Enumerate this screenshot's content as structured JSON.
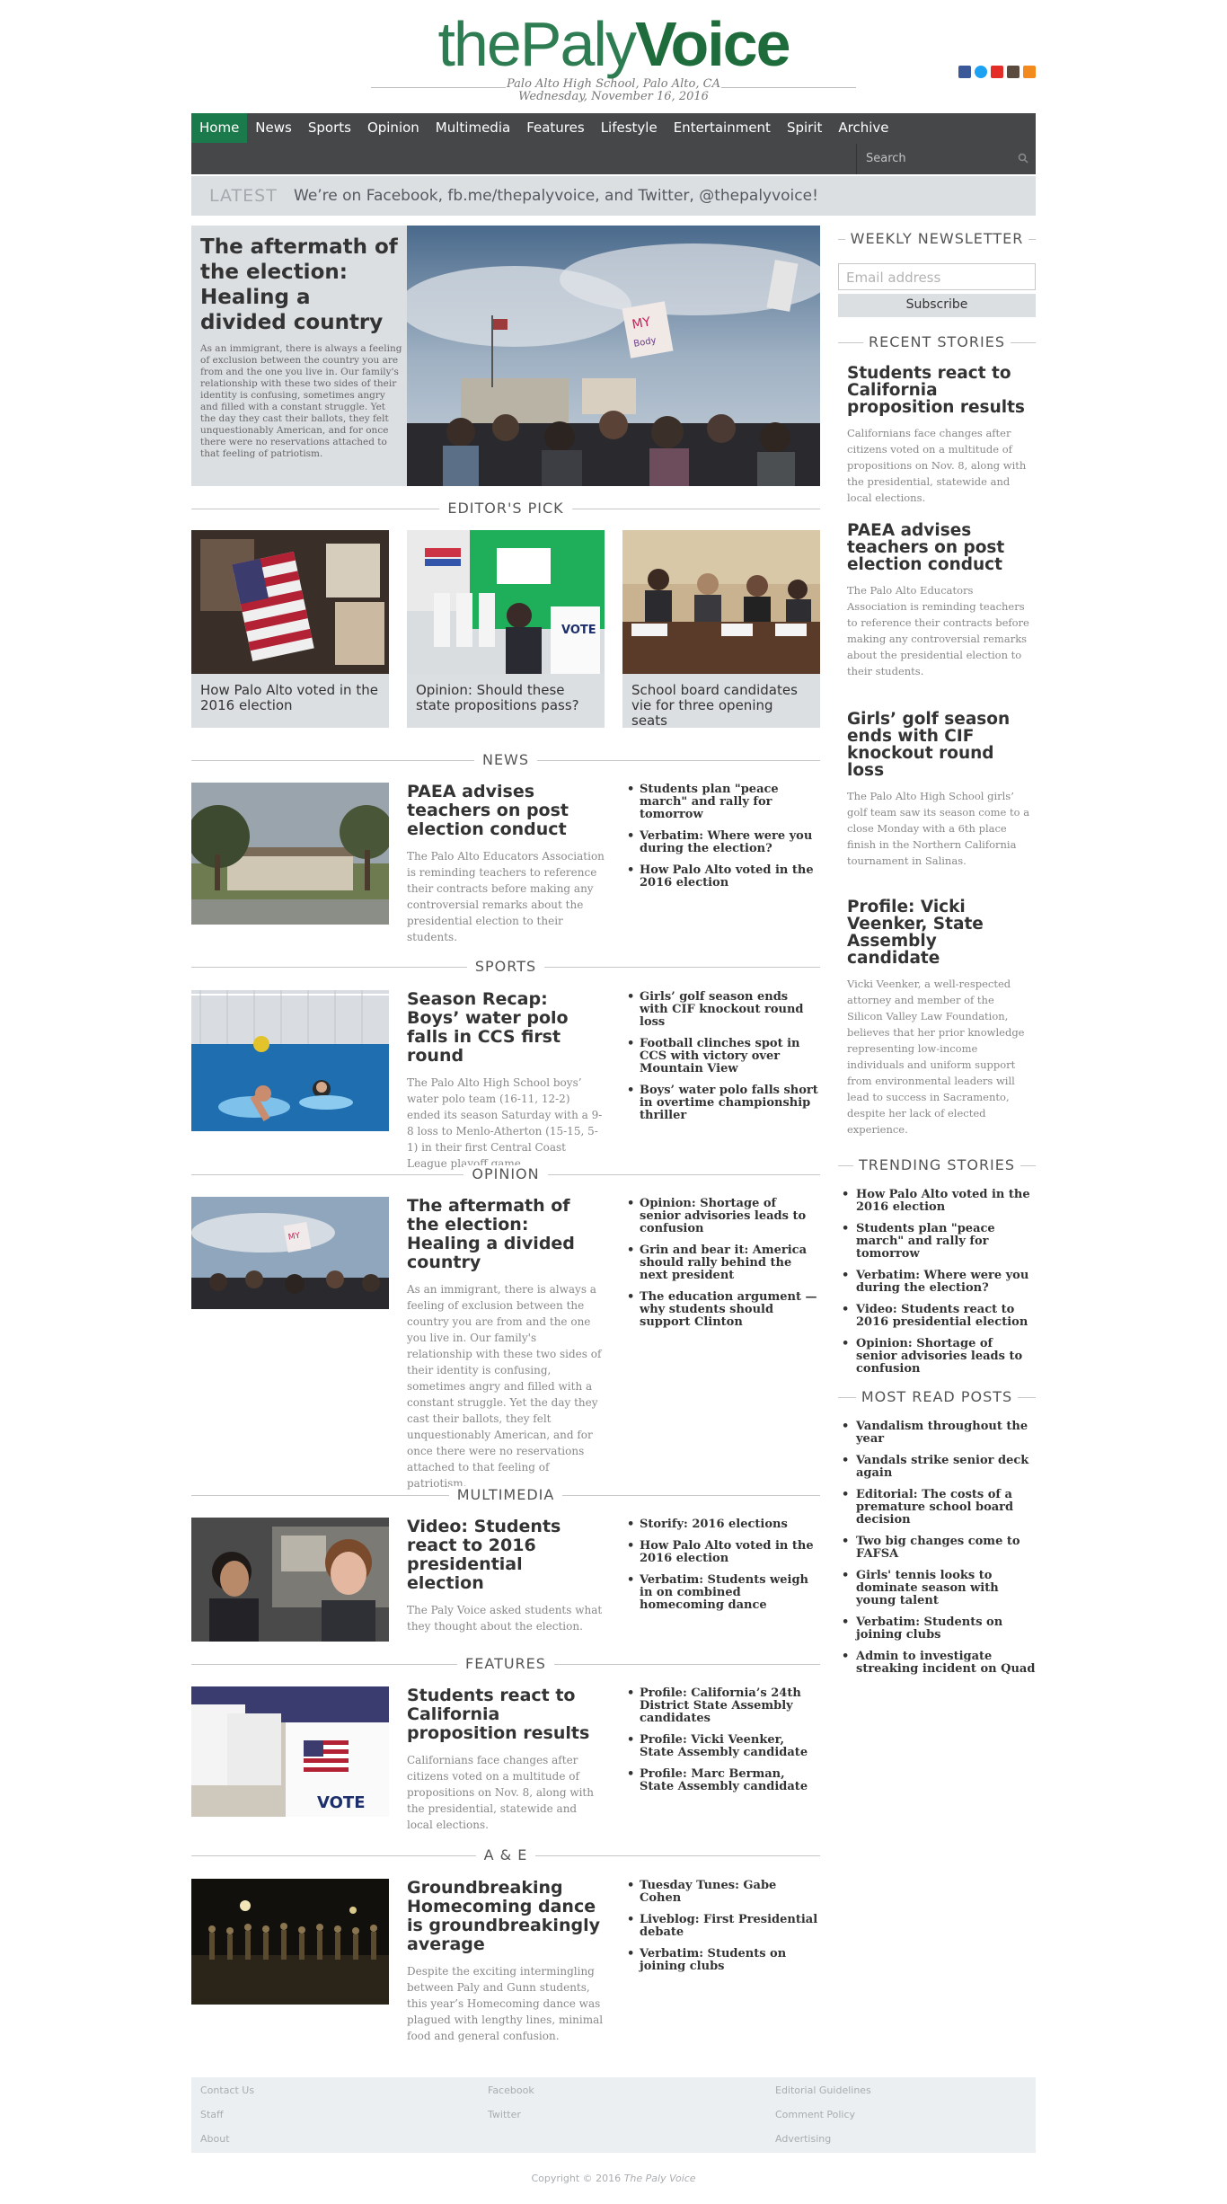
{
  "masthead": {
    "logo_part1": "thePaly",
    "logo_part2": "Voice",
    "school": "Palo Alto High School, Palo Alto, CA",
    "date": "Wednesday, November 16, 2016",
    "social_icons": [
      "facebook-icon",
      "twitter-icon",
      "youtube-icon",
      "instagram-icon",
      "rss-icon"
    ]
  },
  "nav": {
    "items": [
      "Home",
      "News",
      "Sports",
      "Opinion",
      "Multimedia",
      "Features",
      "Lifestyle",
      "Entertainment",
      "Spirit",
      "Archive"
    ],
    "active": "Home",
    "search_placeholder": "Search"
  },
  "latest": {
    "tag": "LATEST",
    "message": "We’re on Facebook, fb.me/thepalyvoice, and Twitter, @thepalyvoice!"
  },
  "hero": {
    "title": "The aftermath of the election: Healing a divided country",
    "excerpt": "As an immigrant, there is always a feeling of exclusion between the country you are from and the one you live in. Our family's relationship with these two sides of their identity is confusing, sometimes angry and filled with a constant struggle. Yet the day they cast their ballots, they felt unquestionably American, and for once there were no reservations attached to that feeling of patriotism."
  },
  "editors_pick": {
    "heading": "EDITOR'S PICK",
    "items": [
      "How Palo Alto voted in the 2016 election",
      "Opinion: Should these state propositions pass?",
      "School board candidates vie for three opening seats"
    ]
  },
  "sections": [
    {
      "heading": "NEWS",
      "title": "PAEA advises teachers on post election conduct",
      "excerpt": "The Palo Alto Educators Association is reminding teachers to reference their contracts before making any controversial remarks about the presidential election to their students.",
      "links": [
        "Students plan \"peace march\" and rally for tomorrow",
        "Verbatim: Where were you during the election?",
        "How Palo Alto voted in the 2016 election"
      ]
    },
    {
      "heading": "SPORTS",
      "title": "Season Recap: Boys’ water polo falls in CCS first round",
      "excerpt": "The Palo Alto High School boys’ water polo team (16-11, 12-2) ended its season Saturday with a 9-8 loss to Menlo-Atherton (15-15, 5-1) in their first Central Coast League playoff game.",
      "links": [
        "Girls’ golf season ends with CIF knockout round loss",
        "Football clinches spot in CCS with victory over Mountain View",
        "Boys’ water polo falls short in overtime championship thriller"
      ]
    },
    {
      "heading": "OPINION",
      "title": "The aftermath of the election: Healing a divided country",
      "excerpt": "As an immigrant, there is always a feeling of exclusion between the country you are from and the one you live in. Our family's relationship with these two sides of their identity is confusing, sometimes angry and filled with a constant struggle. Yet the day they cast their ballots, they felt unquestionably American, and for once there were no reservations attached to that feeling of patriotism.",
      "links": [
        "Opinion: Shortage of senior advisories leads to confusion",
        "Grin and bear it: America should rally behind the next president",
        "The education argument — why students should support Clinton"
      ]
    },
    {
      "heading": "MULTIMEDIA",
      "title": "Video: Students react to 2016 presidential election",
      "excerpt": "The Paly Voice asked students what they thought about the election.",
      "links": [
        "Storify: 2016 elections",
        "How Palo Alto voted in the 2016 election",
        "Verbatim: Students weigh in on combined homecoming dance"
      ]
    },
    {
      "heading": "FEATURES",
      "title": "Students react to California proposition results",
      "excerpt": "Californians face changes after citizens voted on a multitude of propositions on Nov. 8, along with the presidential, statewide and local elections.",
      "links": [
        "Profile: California’s 24th District State Assembly candidates",
        "Profile: Vicki Veenker, State Assembly candidate",
        "Profile: Marc Berman, State Assembly candidate"
      ]
    },
    {
      "heading": "A & E",
      "title": "Groundbreaking Homecoming dance is groundbreakingly average",
      "excerpt": "Despite the exciting intermingling between Paly and Gunn students, this year’s Homecoming dance was plagued with lengthy lines, minimal food and general confusion.",
      "links": [
        "Tuesday Tunes: Gabe Cohen",
        "Liveblog: First Presidential debate",
        "Verbatim: Students on joining clubs"
      ]
    }
  ],
  "sidebar": {
    "newsletter": {
      "heading": "WEEKLY NEWSLETTER",
      "placeholder": "Email address",
      "button": "Subscribe"
    },
    "recent": {
      "heading": "RECENT STORIES",
      "stories": [
        {
          "title": "Students react to California proposition results",
          "excerpt": "Californians face changes after citizens voted on a multitude of propositions on Nov. 8, along with the presidential, statewide and local elections."
        },
        {
          "title": "PAEA advises teachers on post election conduct",
          "excerpt": "The Palo Alto Educators Association is reminding teachers to reference their contracts before making any controversial remarks about the presidential election to their students."
        },
        {
          "title": "Girls’ golf season ends with CIF knockout round loss",
          "excerpt": "The Palo Alto High School girls’ golf team saw its season come to a close Monday with a 6th place finish in the Northern California tournament in Salinas."
        },
        {
          "title": "Profile: Vicki Veenker, State Assembly candidate",
          "excerpt": "Vicki Veenker, a well-respected attorney and member of the Silicon Valley Law Foundation, believes that her prior knowledge representing low-income individuals and uniform support from environmental leaders will lead to success in Sacramento, despite her lack of elected experience."
        }
      ]
    },
    "trending": {
      "heading": "TRENDING STORIES",
      "items": [
        "How Palo Alto voted in the 2016 election",
        "Students plan \"peace march\" and rally for tomorrow",
        "Verbatim: Where were you during the election?",
        "Video: Students react to 2016 presidential election",
        "Opinion: Shortage of senior advisories leads to confusion"
      ]
    },
    "most_read": {
      "heading": "MOST READ POSTS",
      "items": [
        "Vandalism throughout the year",
        "Vandals strike senior deck again",
        "Editorial: The costs of a premature school board decision",
        "Two big changes come to FAFSA",
        "Girls' tennis looks to dominate season with young talent",
        "Verbatim: Students on joining clubs",
        "Admin to investigate streaking incident on Quad"
      ]
    }
  },
  "footer": {
    "col1": [
      "Contact Us",
      "Staff",
      "About"
    ],
    "col2": [
      "Facebook",
      "Twitter"
    ],
    "col3": [
      "Editorial Guidelines",
      "Comment Policy",
      "Advertising"
    ],
    "copyright_prefix": "Copyright © 2016",
    "copyright_name": "The Paly Voice"
  },
  "colors": {
    "brand_green": "#1b7a4c",
    "nav_bg": "#454749",
    "panel_gray": "#dcdfe2"
  }
}
